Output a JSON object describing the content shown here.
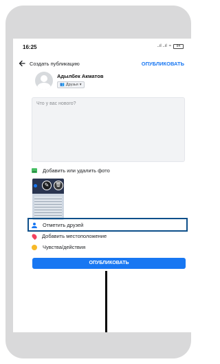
{
  "status_bar": {
    "time": "16:25",
    "signal": "..ıl ..ıl",
    "wifi": "≈",
    "battery": "84"
  },
  "topbar": {
    "back_icon": "arrow-left-icon",
    "title": "Создать публикацию",
    "publish_link": "ОПУБЛИКОВАТЬ"
  },
  "user": {
    "name": "Адылбек Акматов",
    "audience": "Друзья"
  },
  "composer": {
    "placeholder": "Что у вас нового?"
  },
  "options": {
    "photo": "Добавить или удалить фото",
    "tag": "Отметить друзей",
    "location": "Добавить местоположение",
    "feeling": "Чувства/действия"
  },
  "publish_button": "ОПУБЛИКОВАТЬ",
  "colors": {
    "accent": "#1877f2",
    "highlight": "#0d4f8a"
  }
}
